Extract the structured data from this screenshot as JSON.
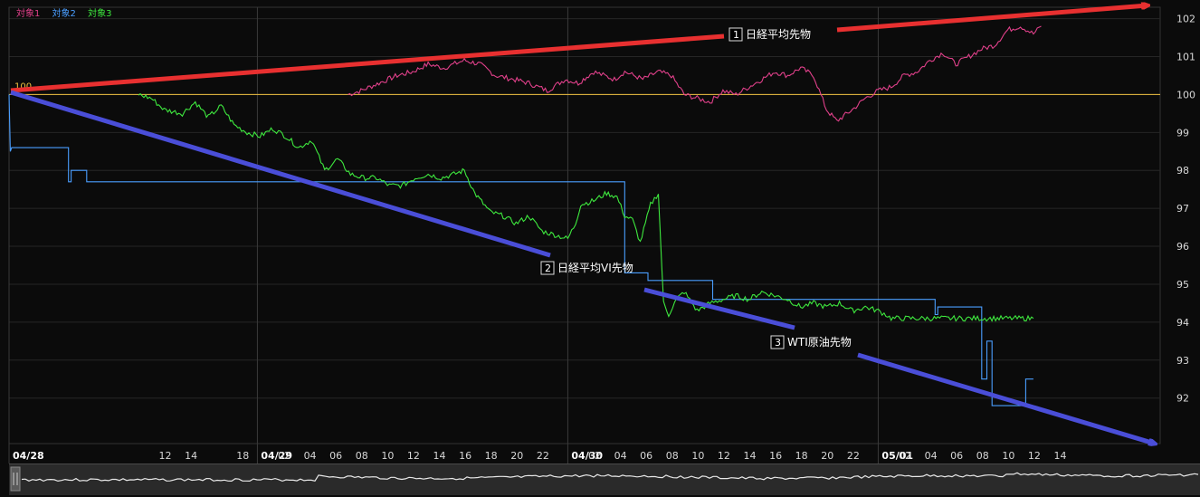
{
  "legend": [
    {
      "label": "対象1",
      "color": "#e0408a"
    },
    {
      "label": "対象2",
      "color": "#4a9eff"
    },
    {
      "label": "対象3",
      "color": "#3ee83e"
    }
  ],
  "baseline_label": "100",
  "annotations": [
    {
      "num": "1",
      "text": "日経平均先物"
    },
    {
      "num": "2",
      "text": "日経平均VI先物"
    },
    {
      "num": "3",
      "text": "WTI原油先物"
    }
  ],
  "colors": {
    "bg": "#0b0b0b",
    "grid": "#262626",
    "baseline": "#f0c040",
    "series1": "#e0408a",
    "series2": "#4a9eff",
    "series3": "#3ee83e",
    "arrow_red": "#e83030",
    "arrow_blue": "#4a4ed8"
  },
  "chart_data": {
    "type": "line",
    "ylim": [
      90.8,
      102.3
    ],
    "yticks": [
      "92",
      "93",
      "94",
      "95",
      "96",
      "97",
      "98",
      "99",
      "100",
      "101",
      "102"
    ],
    "x_unit": "hours",
    "xlim": [
      0,
      89
    ],
    "xticks": [
      {
        "t": 0,
        "label": "04/28",
        "date": true
      },
      {
        "t": 12,
        "label": "12",
        "date": false
      },
      {
        "t": 14,
        "label": "14",
        "date": false
      },
      {
        "t": 18,
        "label": "18",
        "date": false
      },
      {
        "t": 19.2,
        "label": "04/29",
        "date": true
      },
      {
        "t": 21.2,
        "label": "02",
        "date": false
      },
      {
        "t": 23.2,
        "label": "04",
        "date": false
      },
      {
        "t": 25.2,
        "label": "06",
        "date": false
      },
      {
        "t": 27.2,
        "label": "08",
        "date": false
      },
      {
        "t": 29.2,
        "label": "10",
        "date": false
      },
      {
        "t": 31.2,
        "label": "12",
        "date": false
      },
      {
        "t": 33.2,
        "label": "14",
        "date": false
      },
      {
        "t": 35.2,
        "label": "16",
        "date": false
      },
      {
        "t": 37.2,
        "label": "18",
        "date": false
      },
      {
        "t": 39.2,
        "label": "20",
        "date": false
      },
      {
        "t": 41.2,
        "label": "22",
        "date": false
      },
      {
        "t": 43.2,
        "label": "04/30",
        "date": true
      },
      {
        "t": 45.2,
        "label": "02",
        "date": false
      },
      {
        "t": 47.2,
        "label": "04",
        "date": false
      },
      {
        "t": 49.2,
        "label": "06",
        "date": false
      },
      {
        "t": 51.2,
        "label": "08",
        "date": false
      },
      {
        "t": 53.2,
        "label": "10",
        "date": false
      },
      {
        "t": 55.2,
        "label": "12",
        "date": false
      },
      {
        "t": 57.2,
        "label": "14",
        "date": false
      },
      {
        "t": 59.2,
        "label": "16",
        "date": false
      },
      {
        "t": 61.2,
        "label": "18",
        "date": false
      },
      {
        "t": 63.2,
        "label": "20",
        "date": false
      },
      {
        "t": 65.2,
        "label": "22",
        "date": false
      },
      {
        "t": 67.2,
        "label": "05/01",
        "date": true
      },
      {
        "t": 69.2,
        "label": "02",
        "date": false
      },
      {
        "t": 71.2,
        "label": "04",
        "date": false
      },
      {
        "t": 73.2,
        "label": "06",
        "date": false
      },
      {
        "t": 75.2,
        "label": "08",
        "date": false
      },
      {
        "t": 77.2,
        "label": "10",
        "date": false
      },
      {
        "t": 79.2,
        "label": "12",
        "date": false
      },
      {
        "t": 81.2,
        "label": "14",
        "date": false
      }
    ],
    "series": [
      {
        "name": "対象1",
        "color": "#e0408a",
        "step": false,
        "points": [
          [
            26.2,
            100.0
          ],
          [
            27.2,
            100.1
          ],
          [
            28.6,
            100.3
          ],
          [
            30.0,
            100.5
          ],
          [
            31.2,
            100.6
          ],
          [
            32.4,
            100.8
          ],
          [
            33.6,
            100.7
          ],
          [
            35.2,
            100.9
          ],
          [
            36.4,
            100.8
          ],
          [
            37.6,
            100.5
          ],
          [
            39.0,
            100.4
          ],
          [
            40.2,
            100.3
          ],
          [
            41.6,
            100.1
          ],
          [
            43.0,
            100.4
          ],
          [
            44.0,
            100.3
          ],
          [
            45.2,
            100.6
          ],
          [
            46.8,
            100.4
          ],
          [
            47.6,
            100.6
          ],
          [
            49.0,
            100.4
          ],
          [
            50.2,
            100.6
          ],
          [
            51.2,
            100.5
          ],
          [
            52.2,
            100.0
          ],
          [
            53.2,
            99.9
          ],
          [
            54.2,
            99.8
          ],
          [
            55.2,
            100.1
          ],
          [
            56.2,
            100.0
          ],
          [
            57.2,
            100.2
          ],
          [
            58.2,
            100.4
          ],
          [
            59.2,
            100.6
          ],
          [
            60.2,
            100.5
          ],
          [
            61.2,
            100.7
          ],
          [
            62.2,
            100.5
          ],
          [
            63.2,
            99.6
          ],
          [
            64.0,
            99.3
          ],
          [
            65.2,
            99.6
          ],
          [
            66.2,
            99.9
          ],
          [
            67.2,
            100.1
          ],
          [
            68.2,
            100.2
          ],
          [
            69.2,
            100.5
          ],
          [
            70.2,
            100.6
          ],
          [
            71.2,
            100.9
          ],
          [
            72.2,
            101.1
          ],
          [
            73.2,
            100.8
          ],
          [
            74.2,
            101.0
          ],
          [
            75.2,
            101.2
          ],
          [
            76.2,
            101.3
          ],
          [
            77.2,
            101.7
          ],
          [
            78.2,
            101.8
          ],
          [
            79.2,
            101.6
          ],
          [
            79.8,
            101.8
          ]
        ]
      },
      {
        "name": "対象2",
        "color": "#4a9eff",
        "step": true,
        "points": [
          [
            0,
            100.0
          ],
          [
            0.1,
            98.5
          ],
          [
            0.2,
            98.6
          ],
          [
            4.6,
            98.6
          ],
          [
            4.6,
            97.7
          ],
          [
            4.8,
            97.7
          ],
          [
            4.8,
            98.0
          ],
          [
            6.0,
            98.0
          ],
          [
            6.0,
            97.7
          ],
          [
            47.6,
            97.7
          ],
          [
            47.6,
            95.3
          ],
          [
            49.4,
            95.3
          ],
          [
            49.4,
            95.1
          ],
          [
            54.4,
            95.1
          ],
          [
            54.4,
            94.6
          ],
          [
            71.6,
            94.6
          ],
          [
            71.6,
            94.2
          ],
          [
            71.8,
            94.2
          ],
          [
            71.8,
            94.4
          ],
          [
            75.2,
            94.4
          ],
          [
            75.2,
            92.5
          ],
          [
            75.6,
            92.5
          ],
          [
            75.6,
            93.5
          ],
          [
            76.0,
            93.5
          ],
          [
            76.0,
            91.8
          ],
          [
            78.6,
            91.8
          ],
          [
            78.6,
            92.5
          ],
          [
            79.2,
            92.5
          ]
        ]
      },
      {
        "name": "対象3",
        "color": "#3ee83e",
        "step": false,
        "points": [
          [
            10.0,
            100.0
          ],
          [
            11.0,
            99.9
          ],
          [
            12.0,
            99.6
          ],
          [
            13.4,
            99.5
          ],
          [
            14.4,
            99.8
          ],
          [
            15.4,
            99.4
          ],
          [
            16.4,
            99.7
          ],
          [
            17.4,
            99.2
          ],
          [
            18.4,
            99.0
          ],
          [
            19.4,
            98.9
          ],
          [
            20.4,
            99.1
          ],
          [
            21.4,
            98.9
          ],
          [
            22.4,
            98.6
          ],
          [
            23.4,
            98.8
          ],
          [
            24.4,
            98.0
          ],
          [
            25.4,
            98.3
          ],
          [
            26.4,
            97.9
          ],
          [
            27.4,
            97.8
          ],
          [
            28.4,
            97.8
          ],
          [
            29.4,
            97.6
          ],
          [
            30.4,
            97.6
          ],
          [
            31.4,
            97.8
          ],
          [
            32.4,
            97.9
          ],
          [
            33.4,
            97.8
          ],
          [
            34.4,
            97.9
          ],
          [
            35.2,
            98.0
          ],
          [
            36.0,
            97.4
          ],
          [
            37.2,
            96.9
          ],
          [
            38.2,
            96.8
          ],
          [
            39.2,
            96.6
          ],
          [
            40.2,
            96.8
          ],
          [
            41.2,
            96.4
          ],
          [
            42.2,
            96.3
          ],
          [
            43.2,
            96.2
          ],
          [
            43.8,
            96.6
          ],
          [
            44.2,
            97.1
          ],
          [
            45.2,
            97.2
          ],
          [
            46.2,
            97.4
          ],
          [
            47.0,
            97.3
          ],
          [
            47.6,
            96.8
          ],
          [
            48.2,
            96.7
          ],
          [
            48.8,
            96.1
          ],
          [
            49.6,
            97.1
          ],
          [
            50.2,
            97.4
          ],
          [
            50.6,
            94.5
          ],
          [
            51.0,
            94.2
          ],
          [
            51.6,
            94.6
          ],
          [
            52.2,
            94.8
          ],
          [
            53.2,
            94.3
          ],
          [
            54.2,
            94.5
          ],
          [
            55.2,
            94.6
          ],
          [
            56.2,
            94.7
          ],
          [
            57.2,
            94.6
          ],
          [
            58.2,
            94.8
          ],
          [
            59.2,
            94.7
          ],
          [
            60.2,
            94.6
          ],
          [
            61.2,
            94.4
          ],
          [
            62.2,
            94.5
          ],
          [
            63.2,
            94.4
          ],
          [
            64.2,
            94.5
          ],
          [
            65.2,
            94.3
          ],
          [
            66.2,
            94.4
          ],
          [
            67.2,
            94.3
          ],
          [
            67.8,
            94.2
          ],
          [
            68.2,
            94.1
          ],
          [
            73.2,
            94.1
          ],
          [
            79.2,
            94.1
          ]
        ]
      }
    ]
  }
}
